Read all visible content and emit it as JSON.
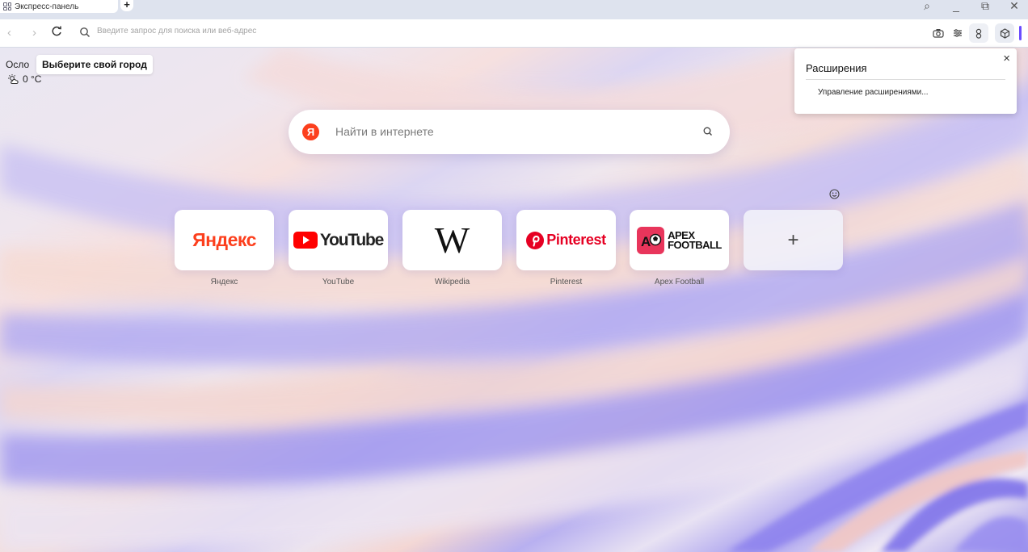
{
  "tab": {
    "title": "Экспресс-панель"
  },
  "new_tab_label": "+",
  "window_controls": {
    "search": "⌕",
    "minimize": "_",
    "restore": "⧉",
    "close": "✕"
  },
  "address_bar": {
    "placeholder": "Введите запрос для поиска или веб-адрес",
    "back": "‹",
    "forward": "›",
    "reload": "C"
  },
  "toolbar_icons": [
    "camera-icon",
    "easy-setup-icon",
    "profile-icon",
    "extensions-icon"
  ],
  "weather": {
    "city": "Осло",
    "city_tooltip": "Выберите свой город",
    "temperature": "0 °C"
  },
  "extensions_popup": {
    "title": "Расширения",
    "manage_link": "Управление расширениями...",
    "close": "×"
  },
  "search": {
    "placeholder": "Найти в интернете",
    "engine_badge": "Я"
  },
  "speed_dials": [
    {
      "label": "Яндекс",
      "logo_text": "Яндекс"
    },
    {
      "label": "YouTube",
      "logo_text": "YouTube"
    },
    {
      "label": "Wikipedia",
      "logo_text": "W"
    },
    {
      "label": "Pinterest",
      "logo_text": "Pinterest"
    },
    {
      "label": "Apex Football",
      "logo_text_1": "APEX",
      "logo_text_2": "FOOTBALL",
      "logo_badge": "AF"
    }
  ],
  "add_dial": {
    "label": "+"
  },
  "colors": {
    "accent": "#6b4cff",
    "yandex_red": "#fc3f1d",
    "youtube_red": "#ff0000",
    "pinterest_red": "#e60023",
    "apex_pink": "#e8355b"
  }
}
